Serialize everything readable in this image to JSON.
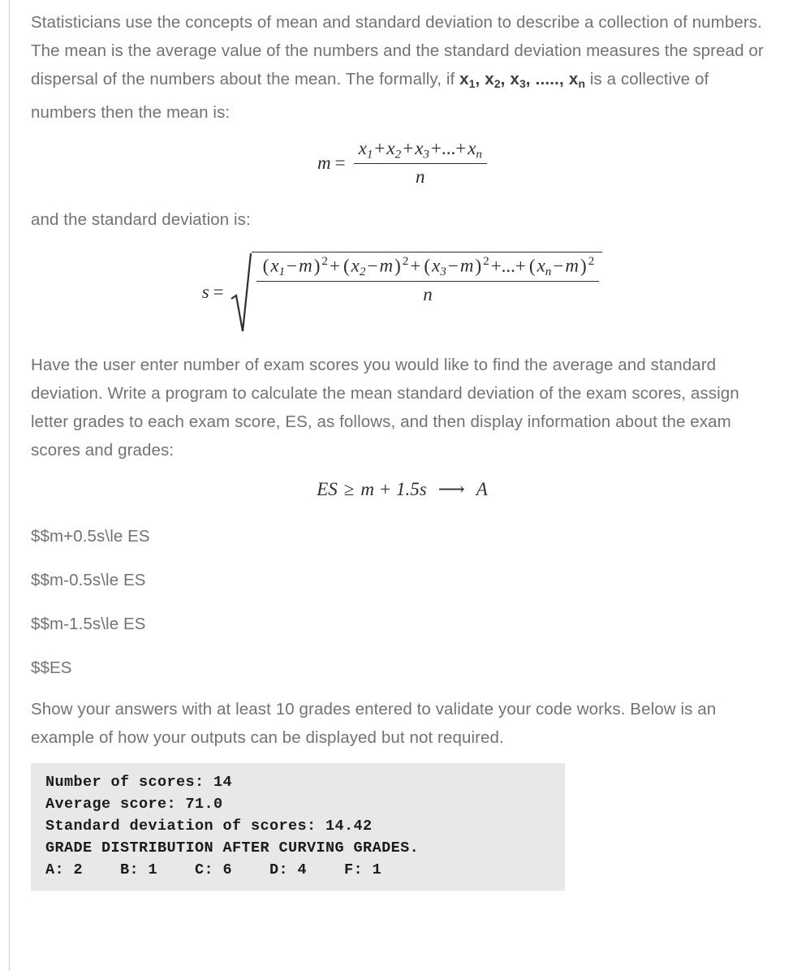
{
  "document": {
    "left_rule_color": "#c9ccd1",
    "body_text_color": "#6f7378",
    "math_text_color": "#2b2f33",
    "code_background": "#e8e8e8",
    "code_text_color": "#1b1b1b"
  },
  "paragraphs": {
    "intro_part1": "Statisticians use the concepts of mean and standard deviation to describe a collection of numbers.  The mean is the average value of the numbers and the standard deviation measures the spread or dispersal of the numbers about the mean.  The formally, if ",
    "intro_vars_1": "x",
    "intro_vars_1_sub": "1",
    "intro_vars_sep1": ", ",
    "intro_vars_2": "x",
    "intro_vars_2_sub": "2",
    "intro_vars_sep2": ", ",
    "intro_vars_3": "x",
    "intro_vars_3_sub": "3",
    "intro_vars_sep3": ", ....., ",
    "intro_vars_n": "x",
    "intro_vars_n_sub": "n",
    "intro_part2": " is a collective of numbers then the mean is:",
    "sd_lead": "and the standard deviation is:",
    "task": "Have the user enter number of exam scores you would like to find the average and standard deviation.  Write a program to calculate the mean standard deviation of the exam scores, assign letter grades to each exam score, ES, as follows, and then display information about the exam scores and grades:",
    "closing": "Show your answers with at least 10 grades entered to validate your code works.   Below is an example of how your outputs can be displayed but not required."
  },
  "equations": {
    "mean": {
      "lhs_var": "m",
      "equals": "=",
      "numerator": {
        "t1_var": "x",
        "t1_sub": "1",
        "plus1": "+",
        "t2_var": "x",
        "t2_sub": "2",
        "plus2": "+",
        "t3_var": "x",
        "t3_sub": "3",
        "plus_dots": "+...+",
        "tn_var": "x",
        "tn_sub": "n"
      },
      "denominator": "n"
    },
    "stddev": {
      "lhs_var": "s",
      "equals": "=",
      "radical_symbol": "sqrt",
      "numerator": {
        "g1": {
          "open": "(",
          "var": "x",
          "sub": "1",
          "minus": "−",
          "mean": "m",
          "close": ")",
          "sup": "2"
        },
        "plus1": "+",
        "g2": {
          "open": "(",
          "var": "x",
          "sub": "2",
          "minus": "−",
          "mean": "m",
          "close": ")",
          "sup": "2"
        },
        "plus2": "+",
        "g3": {
          "open": "(",
          "var": "x",
          "sub": "3",
          "minus": "−",
          "mean": "m",
          "close": ")",
          "sup": "2"
        },
        "plus_dots": "+...+",
        "gn": {
          "open": "(",
          "var": "x",
          "sub": "n",
          "minus": "−",
          "mean": "m",
          "close": ")",
          "sup": "2"
        }
      },
      "denominator": "n"
    },
    "grade_rule": {
      "lhs": "ES",
      "relation": "≥",
      "rhs": "m + 1.5s",
      "arrow": "⟶",
      "grade": "A"
    }
  },
  "raw_latex_lines": [
    "$$m+0.5s\\le ES",
    "$$m-0.5s\\le ES",
    "$$m-1.5s\\le ES",
    "$$ES"
  ],
  "output_example": {
    "lines": [
      "Number of scores: 14",
      "Average score: 71.0",
      "Standard deviation of scores: 14.42",
      "GRADE DISTRIBUTION AFTER CURVING GRADES.",
      "A: 2    B: 1    C: 6    D: 4    F: 1"
    ],
    "values": {
      "number_of_scores": "14",
      "average_score": "71.0",
      "standard_deviation": "14.42",
      "grade_A": "2",
      "grade_B": "1",
      "grade_C": "6",
      "grade_D": "4",
      "grade_F": "1"
    }
  }
}
